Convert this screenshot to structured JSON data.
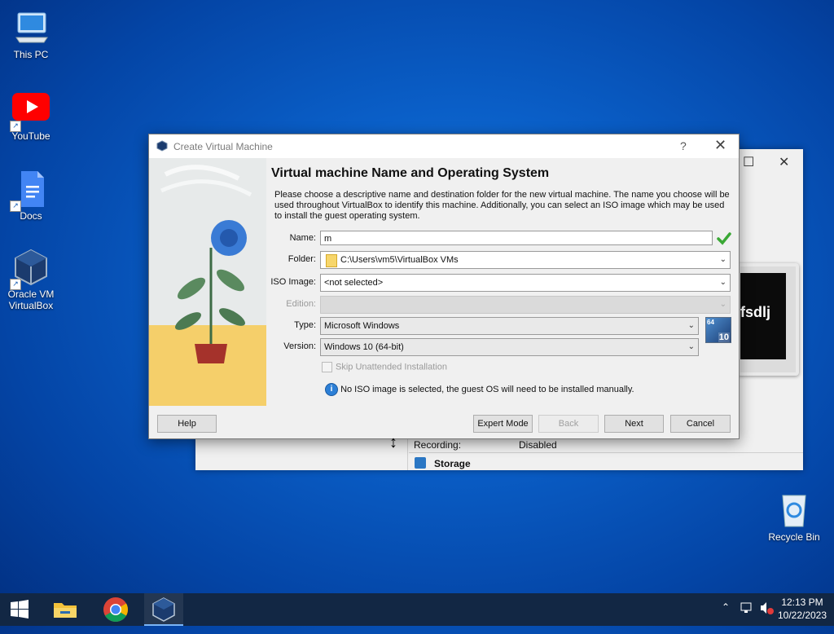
{
  "desktop": {
    "icons": [
      {
        "label": "This PC",
        "icon": "computer-icon"
      },
      {
        "label": "YouTube",
        "icon": "youtube-icon"
      },
      {
        "label": "Docs",
        "icon": "docs-icon"
      },
      {
        "label": "Oracle VM VirtualBox",
        "icon": "virtualbox-icon"
      },
      {
        "label": "Recycle Bin",
        "icon": "recycle-bin-icon"
      }
    ]
  },
  "background_window": {
    "preview_text": "fsdlj",
    "recording_label": "Recording:",
    "recording_value": "Disabled",
    "storage_label": "Storage"
  },
  "dialog": {
    "title": "Create Virtual Machine",
    "help_glyph": "?",
    "close_glyph": "✕",
    "heading": "Virtual machine Name and Operating System",
    "description": "Please choose a descriptive name and destination folder for the new virtual machine. The name you choose will be used throughout VirtualBox to identify this machine. Additionally, you can select an ISO image which may be used to install the guest operating system.",
    "name_label": "Name:",
    "name_value": "m",
    "folder_label": "Folder:",
    "folder_value": "C:\\Users\\vm5\\VirtualBox VMs",
    "iso_label": "ISO Image:",
    "iso_value": "<not selected>",
    "edition_label": "Edition:",
    "edition_value": "",
    "type_label": "Type:",
    "type_value": "Microsoft Windows",
    "version_label": "Version:",
    "version_value": "Windows 10 (64-bit)",
    "os_badge_bits": "64",
    "os_badge_version": "10",
    "skip_unattended_label": "Skip Unattended Installation",
    "info_text": "No ISO image is selected, the guest OS will need to be installed manually.",
    "buttons": {
      "help": "Help",
      "expert": "Expert Mode",
      "back": "Back",
      "next": "Next",
      "cancel": "Cancel"
    }
  },
  "taskbar": {
    "apps": [
      "start-icon",
      "file-explorer-icon",
      "chrome-icon",
      "virtualbox-icon"
    ],
    "clock_time": "12:13 PM",
    "clock_date": "10/22/2023"
  },
  "colors": {
    "desktop_blue": "#0a5fc8",
    "taskbar": "#122744",
    "accent_green": "#3aa835"
  }
}
